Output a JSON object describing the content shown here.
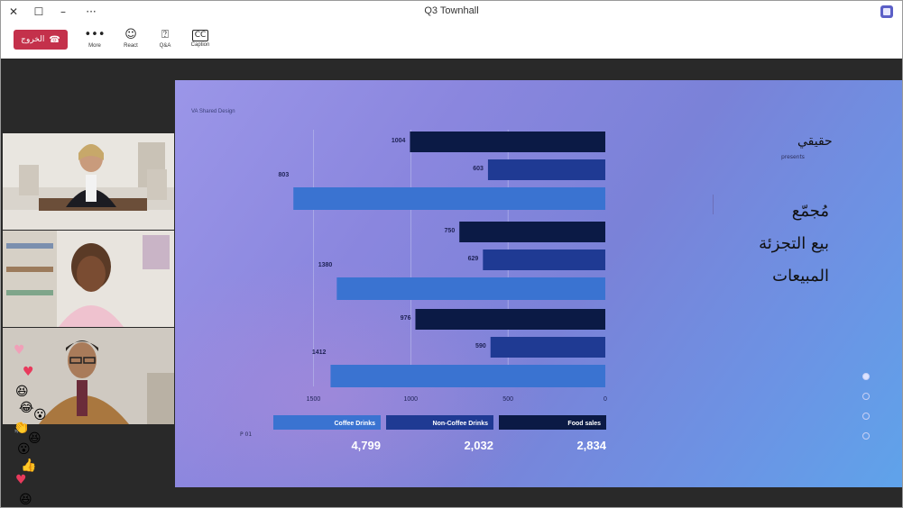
{
  "window": {
    "title": "Q3 Townhall"
  },
  "toolbar": {
    "leave_label": "الخروج",
    "more_label": "More",
    "react_label": "React",
    "qa_label": "Q&A",
    "caption_label": "Caption"
  },
  "slide": {
    "brand_tag": "VA Shared Design",
    "rtl_brand": "حقيقي",
    "rtl_sub": "presents",
    "headline_lines": [
      "مُجمّع",
      "بيع التجزئة",
      "المبيعات"
    ],
    "page_number": "P 01"
  },
  "colors": {
    "leave": "#c4314b",
    "food": "#0b1a45",
    "non_coffee": "#1f3a93",
    "coffee": "#3a73d1"
  },
  "chart_data": {
    "type": "bar",
    "orientation": "horizontal-mirrored",
    "series": [
      {
        "name": "Food sales",
        "values": [
          1004,
          750,
          976
        ],
        "display_labels": [
          "1004",
          "750",
          "976"
        ],
        "total": "2,834"
      },
      {
        "name": "Non-Coffee Drinks",
        "values": [
          603,
          629,
          590
        ],
        "display_labels": [
          "603",
          "629",
          "590"
        ],
        "total": "2,032"
      },
      {
        "name": "Coffee Drinks",
        "values": [
          1603,
          1380,
          1412
        ],
        "display_labels": [
          "803",
          "1380",
          "1412"
        ],
        "total": "4,799"
      }
    ],
    "xticks": [
      "0",
      "500",
      "1000",
      "1500"
    ],
    "xlim": [
      0,
      1600
    ],
    "grid": true,
    "legend_position": "bottom"
  }
}
